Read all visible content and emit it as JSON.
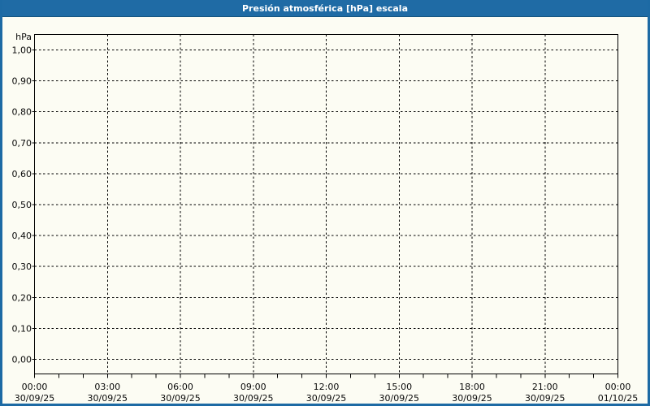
{
  "window": {
    "title": "Presión atmosférica [hPa] escala",
    "title_bar_color": "#1f6ba5",
    "border_color": "#1d6aa4",
    "background_color": "#fcfcf3",
    "title_text_color": "#ffffff"
  },
  "chart_data": {
    "type": "line",
    "title": "Presión atmosférica [hPa] escala",
    "grid": "dashed",
    "legend": "none",
    "series": [],
    "y_axis": {
      "unit_label": "hPa",
      "min": 0.0,
      "max": 1.0,
      "step": 0.1,
      "tick_labels_top_to_bottom": [
        "1,00",
        "0,90",
        "0,80",
        "0,70",
        "0,60",
        "0,50",
        "0,40",
        "0,30",
        "0,20",
        "0,10",
        "0,00"
      ]
    },
    "x_axis": {
      "span_hours": 24,
      "minor_tick_interval_hours": 1,
      "major_tick_interval_hours": 3,
      "major_ticks": [
        {
          "time": "00:00",
          "date": "30/09/25"
        },
        {
          "time": "03:00",
          "date": "30/09/25"
        },
        {
          "time": "06:00",
          "date": "30/09/25"
        },
        {
          "time": "09:00",
          "date": "30/09/25"
        },
        {
          "time": "12:00",
          "date": "30/09/25"
        },
        {
          "time": "15:00",
          "date": "30/09/25"
        },
        {
          "time": "18:00",
          "date": "30/09/25"
        },
        {
          "time": "21:00",
          "date": "30/09/25"
        },
        {
          "time": "00:00",
          "date": "01/10/25"
        }
      ]
    }
  }
}
